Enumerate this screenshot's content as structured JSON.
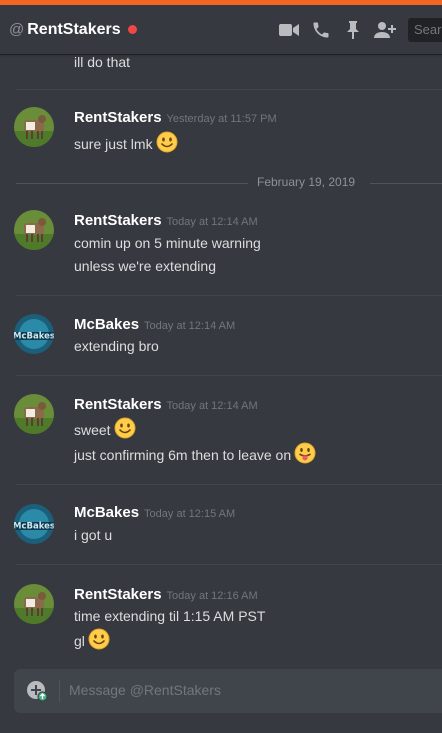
{
  "header": {
    "at_symbol": "@",
    "title": "RentStakers",
    "status_color": "#f04747",
    "icons": [
      "video-call-icon",
      "phone-call-icon",
      "pin-icon",
      "add-friend-icon"
    ],
    "search_placeholder": "Search"
  },
  "messages": [
    {
      "type": "continuation",
      "text": "ill do that"
    },
    {
      "type": "group",
      "author": "RentStakers",
      "avatar": "goat-avatar",
      "timestamp": "Yesterday at 11:57 PM",
      "lines": [
        {
          "text": "sure just lmk",
          "emoji": "smiley"
        }
      ]
    },
    {
      "type": "date",
      "text": "February 19, 2019"
    },
    {
      "type": "group",
      "author": "RentStakers",
      "avatar": "goat-avatar",
      "timestamp": "Today at 12:14 AM",
      "lines": [
        {
          "text": "comin up on 5 minute warning"
        },
        {
          "text": "unless we're extending"
        }
      ]
    },
    {
      "type": "group",
      "author": "McBakes",
      "avatar": "mcbakes-avatar",
      "timestamp": "Today at 12:14 AM",
      "lines": [
        {
          "text": "extending bro"
        }
      ]
    },
    {
      "type": "group",
      "author": "RentStakers",
      "avatar": "goat-avatar",
      "timestamp": "Today at 12:14 AM",
      "lines": [
        {
          "text": "sweet",
          "emoji": "smiley"
        },
        {
          "text": "just confirming 6m then to leave on",
          "emoji": "tongue"
        }
      ]
    },
    {
      "type": "group",
      "author": "McBakes",
      "avatar": "mcbakes-avatar",
      "timestamp": "Today at 12:15 AM",
      "lines": [
        {
          "text": "i got u"
        }
      ]
    },
    {
      "type": "group",
      "author": "RentStakers",
      "avatar": "goat-avatar",
      "timestamp": "Today at 12:16 AM",
      "lines": [
        {
          "text": "time extending til 1:15 AM PST"
        },
        {
          "text": "gl",
          "emoji": "smiley"
        }
      ]
    }
  ],
  "composer": {
    "placeholder": "Message @RentStakers",
    "attach_icon": "plus-upload-icon"
  },
  "colors": {
    "accent_bar": "#f26522",
    "background": "#36393f",
    "input_bg": "#40444b"
  }
}
